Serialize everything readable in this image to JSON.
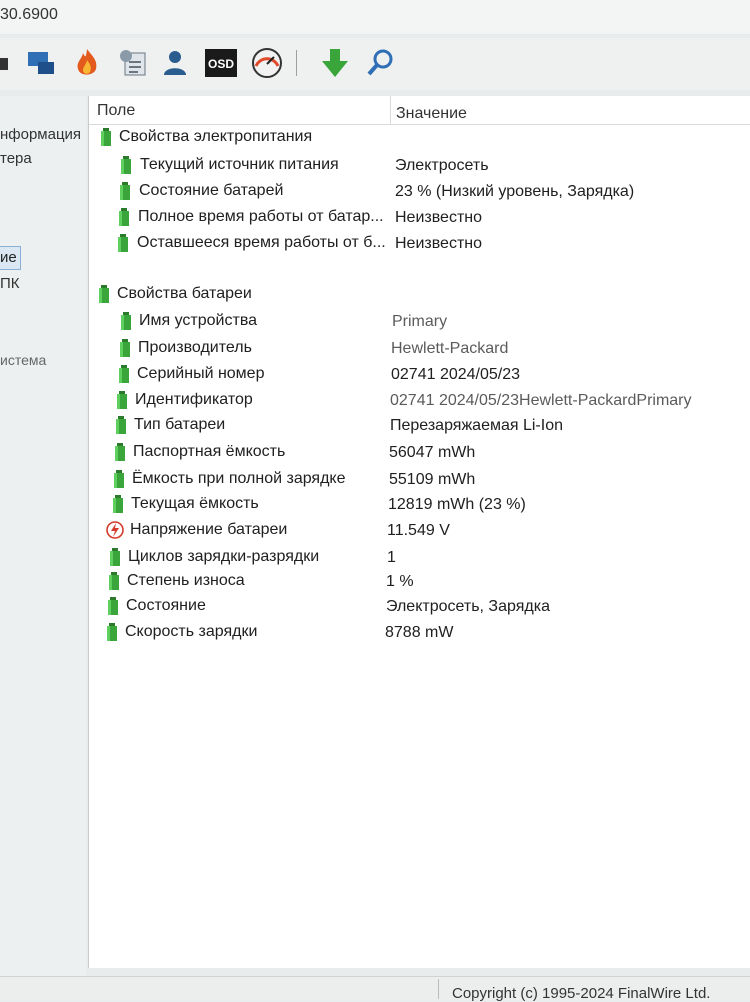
{
  "window": {
    "title": "30.6900"
  },
  "toolbar": {
    "icons": [
      "hardware-icon",
      "network-icon",
      "flame-icon",
      "report-icon",
      "user-icon",
      "osd-icon",
      "gauge-icon",
      "download-icon",
      "search-icon"
    ],
    "osd_label": "OSD"
  },
  "sidebar": {
    "items": [
      {
        "label": "нформация"
      },
      {
        "label": "тера"
      },
      {
        "label": "ие"
      },
      {
        "label": "ПК"
      },
      {
        "label": "истема"
      }
    ]
  },
  "columns": {
    "field": "Поле",
    "value": "Значение"
  },
  "groups": [
    {
      "title": "Свойства электропитания",
      "rows": [
        {
          "field": "Текущий источник питания",
          "value": "Электросеть"
        },
        {
          "field": "Состояние батарей",
          "value": "23 % (Низкий уровень, Зарядка)"
        },
        {
          "field": "Полное время работы от батар...",
          "value": "Неизвестно"
        },
        {
          "field": "Оставшееся время работы от б...",
          "value": "Неизвестно"
        }
      ]
    },
    {
      "title": "Свойства батареи",
      "rows": [
        {
          "field": "Имя устройства",
          "value": "Primary"
        },
        {
          "field": "Производитель",
          "value": "Hewlett-Packard"
        },
        {
          "field": "Серийный номер",
          "value": "02741 2024/05/23"
        },
        {
          "field": "Идентификатор",
          "value": "02741 2024/05/23Hewlett-PackardPrimary"
        },
        {
          "field": "Тип батареи",
          "value": "Перезаряжаемая Li-Ion"
        },
        {
          "field": "Паспортная ёмкость",
          "value": "56047 mWh"
        },
        {
          "field": "Ёмкость при полной зарядке",
          "value": "55109 mWh"
        },
        {
          "field": "Текущая ёмкость",
          "value": "12819 mWh  (23 %)"
        },
        {
          "field": "Напряжение батареи",
          "value": "11.549 V",
          "icon": "voltage-icon"
        },
        {
          "field": "Циклов зарядки-разрядки",
          "value": "1"
        },
        {
          "field": "Степень износа",
          "value": "1 %"
        },
        {
          "field": "Состояние",
          "value": "Электросеть, Зарядка"
        },
        {
          "field": "Скорость зарядки",
          "value": "8788 mW"
        }
      ]
    }
  ],
  "status": {
    "copyright": "Copyright (c) 1995-2024 FinalWire Ltd."
  },
  "colors": {
    "battery_green": "#3aa53a",
    "voltage_red": "#d33a2c",
    "selection": "#dbe8f4"
  }
}
